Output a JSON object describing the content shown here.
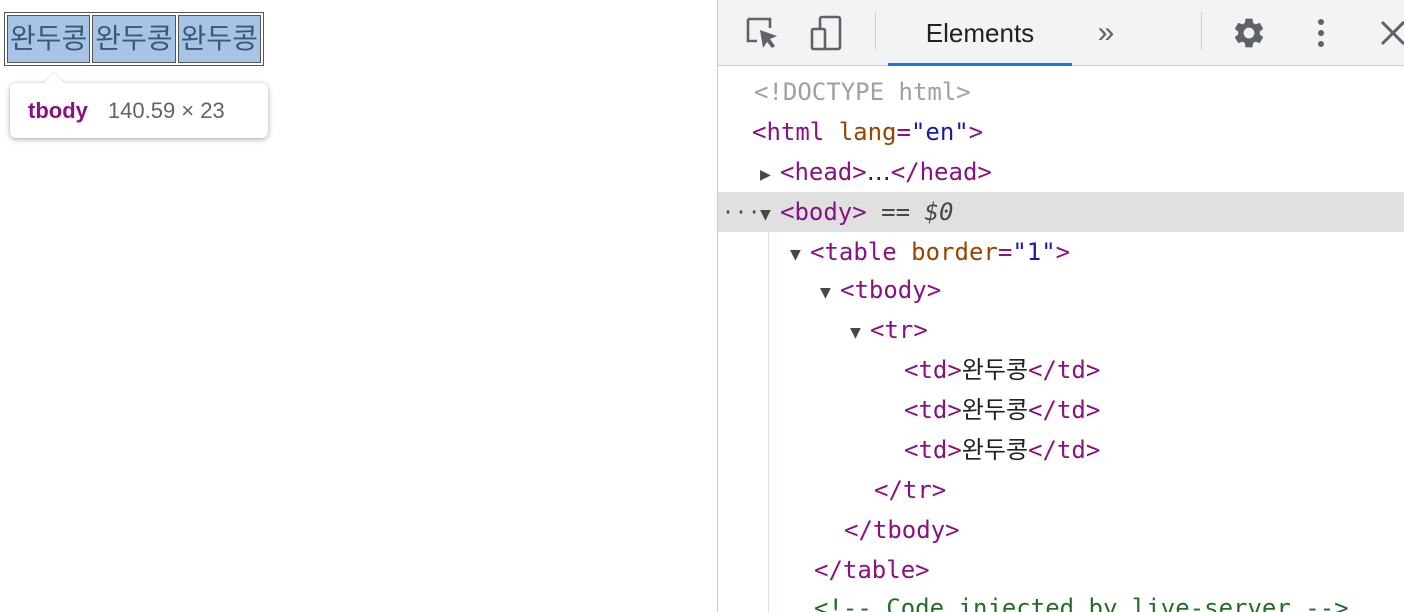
{
  "page": {
    "cells": [
      "완두콩",
      "완두콩",
      "완두콩"
    ],
    "tooltip": {
      "tag": "tbody",
      "dimensions": "140.59 × 23"
    }
  },
  "devtools": {
    "toolbar": {
      "inspect_icon": "inspect-element-icon",
      "device_icon": "device-toolbar-icon",
      "active_tab": "Elements",
      "more_tabs": "»",
      "settings_icon": "gear-icon",
      "menu_icon": "kebab-menu-icon",
      "close_icon": "close-icon"
    },
    "tree": {
      "doctype": "<!DOCTYPE html>",
      "html_open": "<html",
      "lang_attr": "lang",
      "lang_value": "\"en\"",
      "gt": ">",
      "head_open": "<head>",
      "head_ellipsis": "…",
      "head_close": "</head>",
      "body_open": "<body>",
      "selected_marker": "== $0",
      "row_dots": "···",
      "table_open": "<table",
      "border_attr": "border",
      "border_value": "\"1\"",
      "tbody_open": "<tbody>",
      "tr_open": "<tr>",
      "td_open": "<td>",
      "td_text": "완두콩",
      "td_close": "</td>",
      "tr_close": "</tr>",
      "tbody_close": "</tbody>",
      "table_close": "</table>",
      "comment": "<!-- Code injected by live-server -->"
    }
  },
  "colors": {
    "tag": "#881280",
    "attribute": "#994500",
    "value": "#1a1aa6",
    "selection_tab": "#1a73e8",
    "highlight": "#a7c4e6"
  }
}
